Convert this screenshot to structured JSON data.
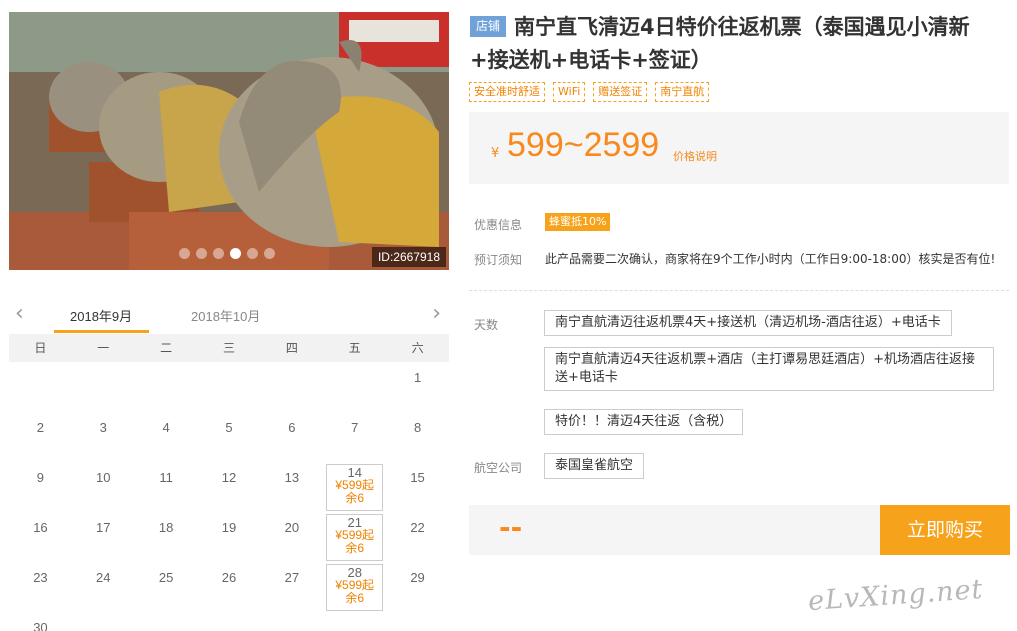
{
  "gallery": {
    "id_label": "ID:2667918",
    "dot_count": 6,
    "active_dot": 4
  },
  "calendar": {
    "prev_icon": "chevron-left-icon",
    "next_icon": "chevron-right-icon",
    "tabs": [
      "2018年9月",
      "2018年10月"
    ],
    "weekdays": [
      "日",
      "一",
      "二",
      "三",
      "四",
      "五",
      "六"
    ],
    "days": [
      {
        "n": ""
      },
      {
        "n": ""
      },
      {
        "n": ""
      },
      {
        "n": ""
      },
      {
        "n": ""
      },
      {
        "n": ""
      },
      {
        "n": "1"
      },
      {
        "n": "2"
      },
      {
        "n": "3"
      },
      {
        "n": "4"
      },
      {
        "n": "5"
      },
      {
        "n": "6"
      },
      {
        "n": "7"
      },
      {
        "n": "8"
      },
      {
        "n": "9"
      },
      {
        "n": "10"
      },
      {
        "n": "11"
      },
      {
        "n": "12"
      },
      {
        "n": "13"
      },
      {
        "n": "14",
        "price": "¥599起",
        "stock": "余6"
      },
      {
        "n": "15"
      },
      {
        "n": "16"
      },
      {
        "n": "17"
      },
      {
        "n": "18"
      },
      {
        "n": "19"
      },
      {
        "n": "20"
      },
      {
        "n": "21",
        "price": "¥599起",
        "stock": "余6"
      },
      {
        "n": "22"
      },
      {
        "n": "23"
      },
      {
        "n": "24"
      },
      {
        "n": "25"
      },
      {
        "n": "26"
      },
      {
        "n": "27"
      },
      {
        "n": "28",
        "price": "¥599起",
        "stock": "余6"
      },
      {
        "n": "29"
      },
      {
        "n": "30"
      }
    ]
  },
  "product": {
    "shop_badge": "店铺",
    "title": "南宁直飞清迈4日特价往返机票（泰国遇见小清新+接送机+电话卡+签证）",
    "tags": [
      "安全准时舒适",
      "WiFi",
      "赠送签证",
      "南宁直航"
    ],
    "price": {
      "currency": "¥",
      "range": "599~2599",
      "explain": "价格说明"
    },
    "discount_label": "优惠信息",
    "discount_badge": "蜂蜜抵10%",
    "notice_label": "预订须知",
    "notice_text": "此产品需要二次确认，商家将在9个工作小时内（工作日9:00-18:00）核实是否有位!",
    "days_label": "天数",
    "day_options": [
      "南宁直航清迈往返机票4天+接送机（清迈机场-酒店往返）+电话卡",
      "南宁直航清迈4天往返机票+酒店（主打谭易思廷酒店）+机场酒店往返接送+电话卡",
      "特价！！清迈4天往返（含税）"
    ],
    "airline_label": "航空公司",
    "airline_option": "泰国皇雀航空",
    "total_placeholder": "--",
    "buy_button": "立即购买"
  },
  "watermark": "eLvXing.net"
}
